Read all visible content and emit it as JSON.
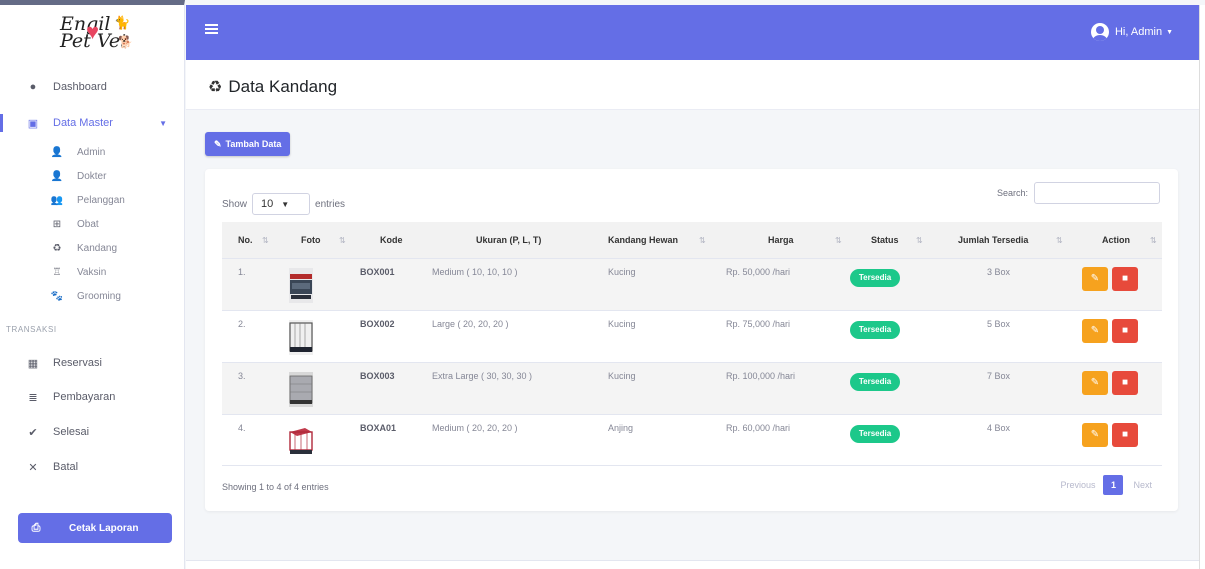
{
  "brand": {
    "line1": "Engil",
    "line2": "Pet Vet"
  },
  "sidebar": {
    "dashboard": {
      "icon": "tint-icon",
      "label": "Dashboard"
    },
    "data_master": {
      "icon": "table-icon",
      "label": "Data Master"
    },
    "sub_items": [
      {
        "icon": "user-icon",
        "label": "Admin"
      },
      {
        "icon": "user-doctor-icon",
        "label": "Dokter"
      },
      {
        "icon": "users-icon",
        "label": "Pelanggan"
      },
      {
        "icon": "medicine-icon",
        "label": "Obat"
      },
      {
        "icon": "recycle-icon",
        "label": "Kandang"
      },
      {
        "icon": "syringe-icon",
        "label": "Vaksin"
      },
      {
        "icon": "paw-icon",
        "label": "Grooming"
      }
    ],
    "section_label": "TRANSAKSI",
    "transaksi": [
      {
        "icon": "grid-icon",
        "label": "Reservasi"
      },
      {
        "icon": "database-icon",
        "label": "Pembayaran"
      },
      {
        "icon": "check-icon",
        "label": "Selesai"
      },
      {
        "icon": "times-icon",
        "label": "Batal"
      }
    ],
    "cetak": {
      "icon": "print-icon",
      "label": "Cetak Laporan"
    }
  },
  "topbar": {
    "user_label": "Hi, Admin"
  },
  "page": {
    "title": "Data Kandang",
    "title_icon": "recycle-icon"
  },
  "toolbar": {
    "tambah_label": "Tambah Data"
  },
  "table": {
    "show_label": "Show",
    "entries_value": "10",
    "entries_label": "entries",
    "search_label": "Search:",
    "search_value": "",
    "columns": [
      "No.",
      "Foto",
      "Kode",
      "Ukuran (P, L, T)",
      "Kandang Hewan",
      "Harga",
      "Status",
      "Jumlah Tersedia",
      "Action"
    ],
    "rows": [
      {
        "no": "1.",
        "kode": "BOX001",
        "ukuran": "Medium ( 10, 10, 10 )",
        "hewan": "Kucing",
        "harga": "Rp. 50,000 /hari",
        "status": "Tersedia",
        "jumlah": "3 Box"
      },
      {
        "no": "2.",
        "kode": "BOX002",
        "ukuran": "Large ( 20, 20, 20 )",
        "hewan": "Kucing",
        "harga": "Rp. 75,000 /hari",
        "status": "Tersedia",
        "jumlah": "5 Box"
      },
      {
        "no": "3.",
        "kode": "BOX003",
        "ukuran": "Extra Large ( 30, 30, 30 )",
        "hewan": "Kucing",
        "harga": "Rp. 100,000 /hari",
        "status": "Tersedia",
        "jumlah": "7 Box"
      },
      {
        "no": "4.",
        "kode": "BOXA01",
        "ukuran": "Medium ( 20, 20, 20 )",
        "hewan": "Anjing",
        "harga": "Rp. 60,000 /hari",
        "status": "Tersedia",
        "jumlah": "4 Box"
      }
    ],
    "info": "Showing 1 to 4 of 4 entries",
    "pagination": {
      "previous": "Previous",
      "current": "1",
      "next": "Next"
    }
  },
  "colors": {
    "accent": "#646ee6",
    "success": "#1cc88a",
    "warning": "#f6a21e",
    "danger": "#e74a3b"
  }
}
